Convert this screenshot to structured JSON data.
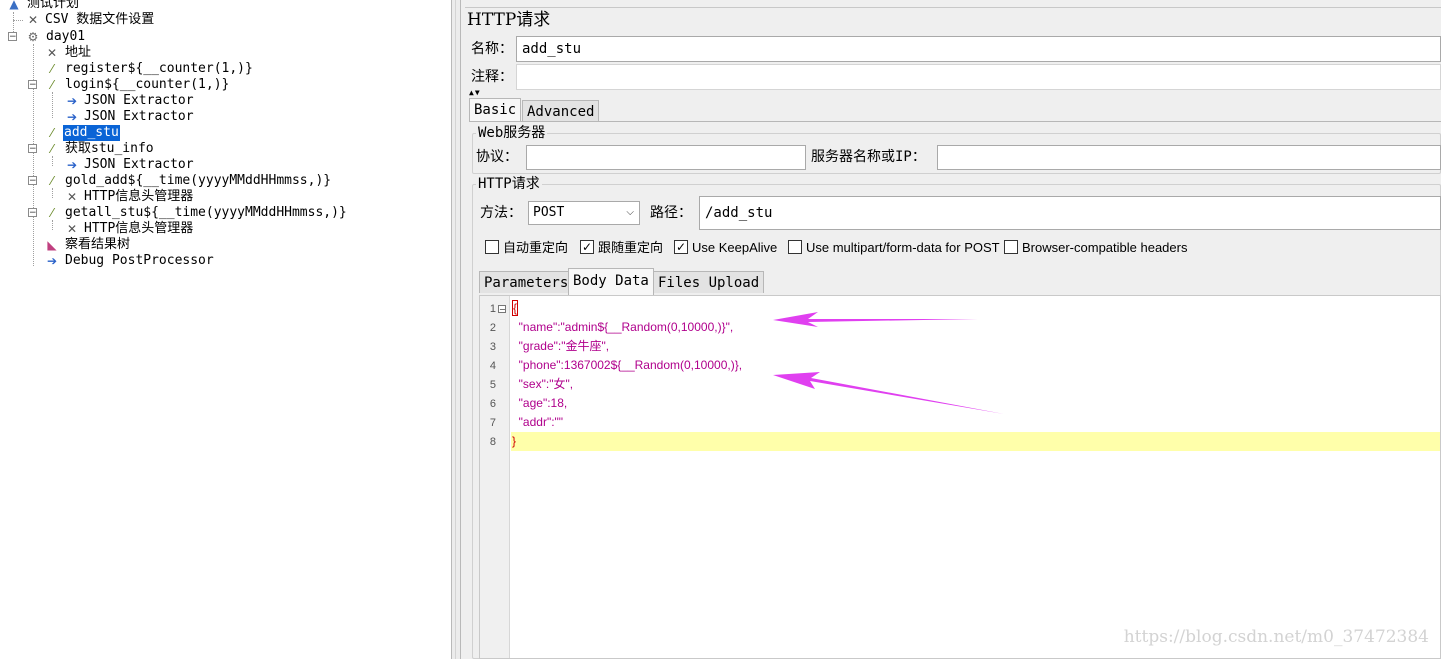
{
  "tree": {
    "nodes": [
      {
        "label": "测试计划",
        "icon": "test-plan-icon"
      },
      {
        "label": "CSV 数据文件设置",
        "icon": "config-wrench-icon"
      },
      {
        "label": "day01",
        "icon": "thread-group-gear-icon"
      },
      {
        "label": "地址",
        "icon": "config-wrench-icon"
      },
      {
        "label": "register${__counter(1,)}",
        "icon": "sampler-pipette-icon"
      },
      {
        "label": "login${__counter(1,)}",
        "icon": "sampler-pipette-icon"
      },
      {
        "label": "JSON Extractor",
        "icon": "post-processor-arrow-icon"
      },
      {
        "label": "JSON Extractor",
        "icon": "post-processor-arrow-icon"
      },
      {
        "label": "add_stu",
        "icon": "sampler-pipette-icon"
      },
      {
        "label": "获取stu_info",
        "icon": "sampler-pipette-icon"
      },
      {
        "label": "JSON Extractor",
        "icon": "post-processor-arrow-icon"
      },
      {
        "label": "gold_add${__time(yyyyMMddHHmmss,)}",
        "icon": "sampler-pipette-icon"
      },
      {
        "label": "HTTP信息头管理器",
        "icon": "config-wrench-icon"
      },
      {
        "label": "getall_stu${__time(yyyyMMddHHmmss,)}",
        "icon": "sampler-pipette-icon"
      },
      {
        "label": "HTTP信息头管理器",
        "icon": "config-wrench-icon"
      },
      {
        "label": "察看结果树",
        "icon": "listener-chart-icon"
      },
      {
        "label": "Debug PostProcessor",
        "icon": "post-processor-arrow-icon"
      }
    ],
    "selected_label": "add_stu"
  },
  "panel": {
    "title": "HTTP请求",
    "name_label": "名称：",
    "name_value": "add_stu",
    "comments_label": "注释：",
    "comments_value": "",
    "tabs": [
      "Basic",
      "Advanced"
    ],
    "active_tab": "Basic",
    "web_server": {
      "group_title": "Web服务器",
      "protocol_label": "协议：",
      "protocol_value": "",
      "server_label": "服务器名称或IP：",
      "server_value": ""
    },
    "http_request": {
      "group_title": "HTTP请求",
      "method_label": "方法：",
      "method_value": "POST",
      "path_label": "路径：",
      "path_value": "/add_stu"
    },
    "checkboxes": [
      {
        "label": "自动重定向",
        "checked": false
      },
      {
        "label": "跟随重定向",
        "checked": true
      },
      {
        "label": "Use KeepAlive",
        "checked": true
      },
      {
        "label": "Use multipart/form-data for POST",
        "checked": false
      },
      {
        "label": "Browser-compatible headers",
        "checked": false
      }
    ],
    "body_tabs": [
      "Parameters",
      "Body Data",
      "Files Upload"
    ],
    "active_body_tab": "Body Data",
    "body_lines": [
      {
        "num": "1",
        "text": "{"
      },
      {
        "num": "2",
        "text": "  \"name\":\"admin${__Random(0,10000,)}\","
      },
      {
        "num": "3",
        "text": "  \"grade\":\"金牛座\","
      },
      {
        "num": "4",
        "text": "  \"phone\":1367002${__Random(0,10000,)},"
      },
      {
        "num": "5",
        "text": "  \"sex\":\"女\","
      },
      {
        "num": "6",
        "text": "  \"age\":18,"
      },
      {
        "num": "7",
        "text": "  \"addr\":\"\""
      },
      {
        "num": "8",
        "text": "}"
      }
    ]
  },
  "watermark": "https://blog.csdn.net/m0_37472384",
  "colors": {
    "selection": "#0a64d6",
    "annotation_arrow": "#e040f0",
    "current_line": "#ffffaa"
  }
}
